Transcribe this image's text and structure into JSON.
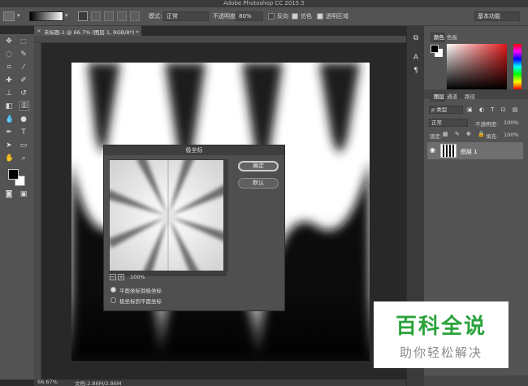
{
  "app": {
    "title": "Adobe Photoshop CC 2015.5"
  },
  "options_bar": {
    "mode_label": "模式:",
    "mode_value": "正常",
    "opacity_label": "不透明度:",
    "opacity_value": "80%",
    "reverse_label": "反向",
    "dither_label": "仿色",
    "transparency_label": "透明区域",
    "reverse_checked": false,
    "dither_checked": true,
    "transparency_checked": true,
    "workspace_value": "基本功能"
  },
  "document": {
    "tab_label": "未标题-1 @ 66.7% (图层 1, RGB/8*) *"
  },
  "status_bar": {
    "zoom": "66.67%",
    "doc_info": "文档:2.86M/2.86M"
  },
  "dialog": {
    "title": "极坐标",
    "ok_label": "确定",
    "default_label": "默认",
    "zoom_value": "100%",
    "zoom_out": "−",
    "zoom_in": "+",
    "option_rect_to_polar": "平面坐标到极坐标",
    "option_polar_to_rect": "极坐标到平面坐标",
    "selected_option": "rect_to_polar"
  },
  "panels": {
    "color_tabs": [
      "颜色",
      "色板"
    ],
    "layers_tabs": [
      "图层",
      "通道",
      "路径"
    ],
    "kind_filter": "ρ 类型",
    "blend_mode": "正常",
    "opacity_label": "不透明度:",
    "opacity_value": "100%",
    "lock_label": "锁定:",
    "fill_label": "填充:",
    "fill_value": "100%",
    "layer_name": "图层 1"
  },
  "colors": {
    "accent_red": "#e01818",
    "foreground": "#000000",
    "background": "#ffffff"
  },
  "watermark": {
    "line1": "百科全说",
    "line2": "助你轻松解决"
  }
}
